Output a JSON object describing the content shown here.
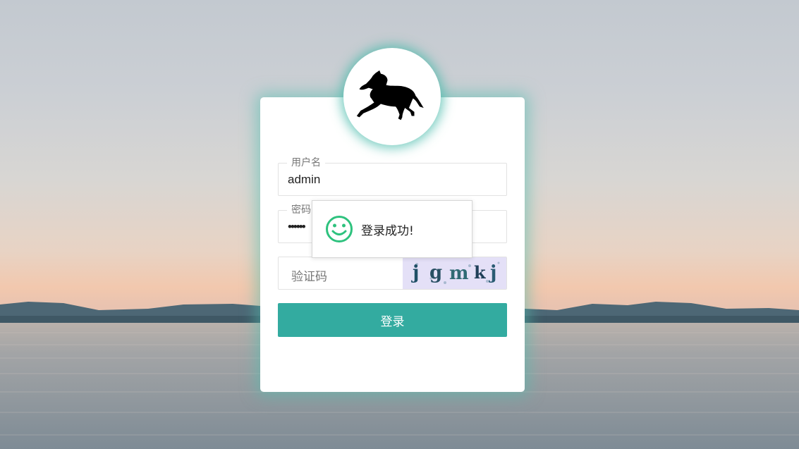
{
  "login": {
    "username_label": "用户名",
    "username_value": "admin",
    "password_label": "密码",
    "password_value": "••••••",
    "captcha_placeholder": "验证码",
    "captcha_text": "jgmkj",
    "submit_label": "登录"
  },
  "toast": {
    "message": "登录成功!",
    "icon": "smile-icon",
    "color": "#2ec27e"
  },
  "colors": {
    "accent": "#33aba0",
    "glow": "#50beaf"
  }
}
